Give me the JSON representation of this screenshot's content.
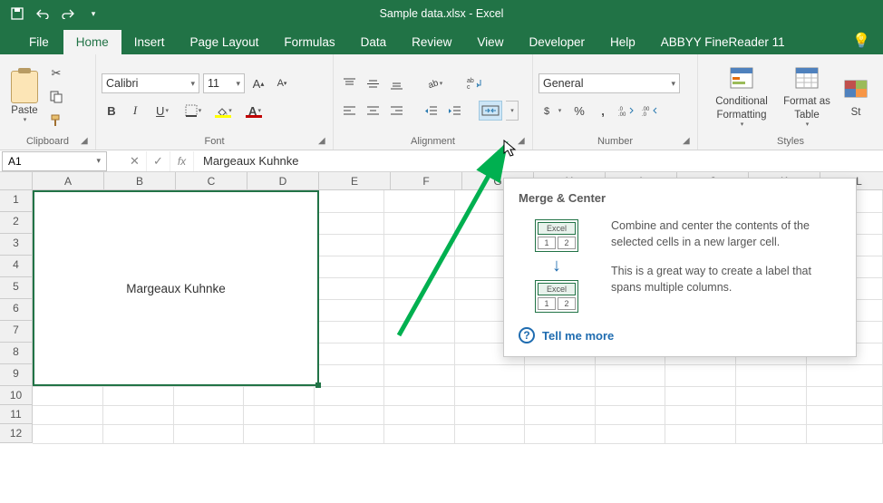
{
  "title": "Sample data.xlsx - Excel",
  "tabs": [
    "File",
    "Home",
    "Insert",
    "Page Layout",
    "Formulas",
    "Data",
    "Review",
    "View",
    "Developer",
    "Help",
    "ABBYY FineReader 11"
  ],
  "active_tab": "Home",
  "groups": {
    "clipboard": {
      "label": "Clipboard",
      "paste": "Paste"
    },
    "font": {
      "label": "Font",
      "name": "Calibri",
      "size": "11"
    },
    "alignment": {
      "label": "Alignment"
    },
    "number": {
      "label": "Number",
      "format": "General"
    },
    "styles": {
      "label": "Styles",
      "cond": "Conditional Formatting",
      "fmt_table": "Format as Table",
      "st": "St"
    }
  },
  "namebox": "A1",
  "formula": "Margeaux Kuhnke",
  "columns": [
    "A",
    "B",
    "C",
    "D",
    "E",
    "F",
    "G",
    "H",
    "I",
    "J",
    "K",
    "L"
  ],
  "rows": [
    "1",
    "2",
    "3",
    "4",
    "5",
    "6",
    "7",
    "8",
    "9",
    "10",
    "11",
    "12"
  ],
  "merged_value": "Margeaux Kuhnke",
  "tooltip": {
    "title": "Merge & Center",
    "para1": "Combine and center the contents of the selected cells in a new larger cell.",
    "para2": "This is a great way to create a label that spans multiple columns.",
    "more": "Tell me more",
    "illus_label": "Excel",
    "illus_c1": "1",
    "illus_c2": "2"
  }
}
